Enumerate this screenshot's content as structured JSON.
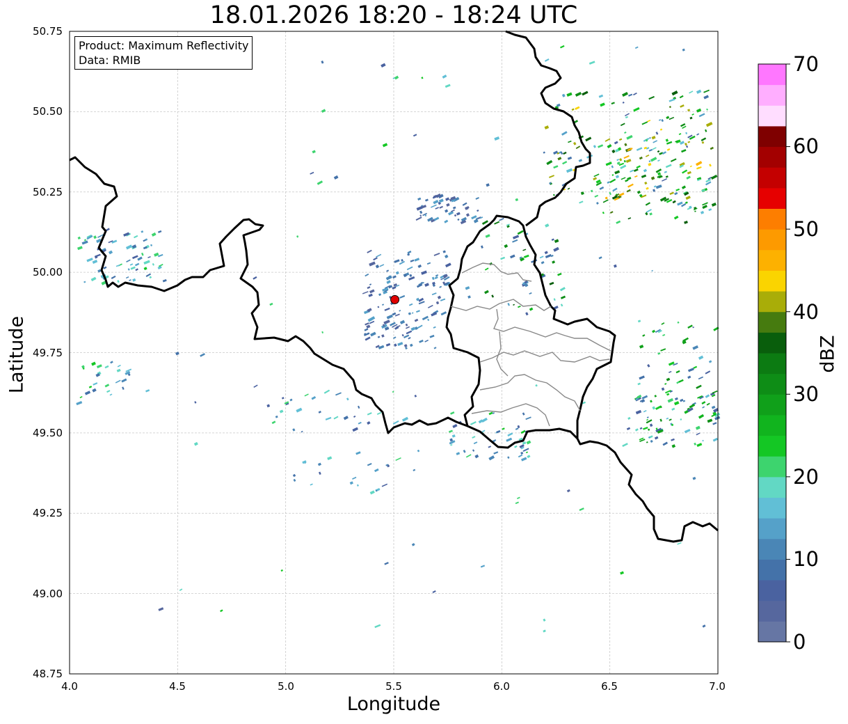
{
  "title": "18.01.2026 18:20 - 18:24 UTC",
  "info_box": {
    "product": "Product: Maximum Reflectivity",
    "data": "Data: RMIB"
  },
  "axes": {
    "xlabel": "Longitude",
    "ylabel": "Latitude",
    "xlim": [
      4.0,
      7.0
    ],
    "ylim": [
      48.75,
      50.75
    ],
    "xticks": [
      "4.0",
      "4.5",
      "5.0",
      "5.5",
      "6.0",
      "6.5",
      "7.0"
    ],
    "yticks": [
      "50.75",
      "50.50",
      "50.25",
      "50.00",
      "49.75",
      "49.50",
      "49.25",
      "49.00",
      "48.75"
    ],
    "grid": true
  },
  "radar_site": {
    "lon": 5.505,
    "lat": 49.915,
    "color": "#e00000"
  },
  "colorbar": {
    "label": "dBZ",
    "ticks": [
      "0",
      "10",
      "20",
      "30",
      "40",
      "50",
      "60",
      "70"
    ],
    "range": [
      0,
      70
    ],
    "step": 2.5,
    "colors": [
      "#6676a4",
      "#56679e",
      "#4a62a0",
      "#4472a9",
      "#4a86b6",
      "#55a1c9",
      "#61bfd6",
      "#62d8c4",
      "#3dd46e",
      "#14c724",
      "#11b41e",
      "#10a01a",
      "#0e8d16",
      "#0c7b12",
      "#095e0c",
      "#467b0f",
      "#a9ad08",
      "#fad400",
      "#fdb100",
      "#fd9a00",
      "#fd7e00",
      "#e60000",
      "#c40000",
      "#a30000",
      "#7f0000",
      "#ffddff",
      "#ffaeff",
      "#ff77ff",
      "#f03cf0"
    ],
    "color_notes": {
      "low": "blue",
      "mid": "green",
      "high": "yellow-red",
      "extreme": "pink"
    }
  }
}
